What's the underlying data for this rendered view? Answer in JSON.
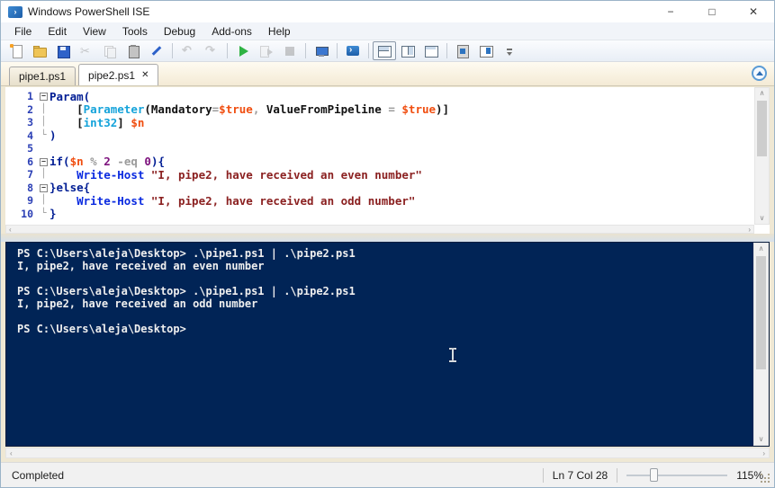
{
  "window": {
    "title": "Windows PowerShell ISE",
    "controls": {
      "minimize": "−",
      "maximize": "□",
      "close": "✕"
    }
  },
  "menu": {
    "items": [
      "File",
      "Edit",
      "View",
      "Tools",
      "Debug",
      "Add-ons",
      "Help"
    ]
  },
  "toolbar": {
    "buttons": [
      {
        "name": "new-script"
      },
      {
        "name": "open-script"
      },
      {
        "name": "save-script"
      },
      {
        "name": "cut",
        "disabled": true
      },
      {
        "name": "copy",
        "disabled": true
      },
      {
        "name": "paste"
      },
      {
        "name": "clear-console-pane"
      },
      {
        "sep": true
      },
      {
        "name": "undo",
        "disabled": true
      },
      {
        "name": "redo",
        "disabled": true
      },
      {
        "sep": true
      },
      {
        "name": "run-script"
      },
      {
        "name": "run-selection",
        "disabled": true
      },
      {
        "name": "stop-operation",
        "disabled": true
      },
      {
        "sep": true
      },
      {
        "name": "new-remote-powershell-tab"
      },
      {
        "sep": true
      },
      {
        "name": "start-powershell"
      },
      {
        "sep": true
      },
      {
        "name": "script-pane-top",
        "selected": true
      },
      {
        "name": "script-pane-right"
      },
      {
        "name": "script-pane-maximized"
      },
      {
        "sep": true
      },
      {
        "name": "show-command-window"
      },
      {
        "name": "show-command-addon"
      },
      {
        "name": "toolbar-overflow"
      }
    ]
  },
  "tabs": {
    "items": [
      {
        "label": "pipe1.ps1",
        "active": false
      },
      {
        "label": "pipe2.ps1",
        "active": true
      }
    ],
    "close_glyph": "✕"
  },
  "editor": {
    "lines": [
      {
        "n": "1",
        "fold": "minus",
        "guide": "",
        "tokens": [
          [
            "Param(",
            "kw"
          ]
        ]
      },
      {
        "n": "2",
        "fold": "",
        "guide": "│",
        "tokens": [
          [
            "    [",
            "pl"
          ],
          [
            "Parameter",
            "ty"
          ],
          [
            "(",
            "pl"
          ],
          [
            "Mandatory",
            "pl"
          ],
          [
            "=",
            "op"
          ],
          [
            "$true",
            "va"
          ],
          [
            ", ",
            "op"
          ],
          [
            "ValueFromPipeline",
            "pl"
          ],
          [
            " = ",
            "op"
          ],
          [
            "$true",
            "va"
          ],
          [
            ")]",
            "pl"
          ]
        ]
      },
      {
        "n": "3",
        "fold": "",
        "guide": "│",
        "tokens": [
          [
            "    [",
            "pl"
          ],
          [
            "int32",
            "ty"
          ],
          [
            "] ",
            "pl"
          ],
          [
            "$n",
            "va"
          ]
        ]
      },
      {
        "n": "4",
        "fold": "",
        "guide": "└",
        "tokens": [
          [
            ")",
            "kw"
          ]
        ]
      },
      {
        "n": "5",
        "fold": "",
        "guide": "",
        "tokens": []
      },
      {
        "n": "6",
        "fold": "minus",
        "guide": "",
        "tokens": [
          [
            "if(",
            "kw"
          ],
          [
            "$n",
            "va"
          ],
          [
            " ",
            "pl"
          ],
          [
            "%",
            "op"
          ],
          [
            " ",
            "pl"
          ],
          [
            "2",
            "nu"
          ],
          [
            " ",
            "pl"
          ],
          [
            "-eq",
            "op"
          ],
          [
            " ",
            "pl"
          ],
          [
            "0",
            "nu"
          ],
          [
            "){",
            "kw"
          ]
        ]
      },
      {
        "n": "7",
        "fold": "",
        "guide": "│",
        "tokens": [
          [
            "    ",
            "pl"
          ],
          [
            "Write-Host",
            "cm"
          ],
          [
            " ",
            "pl"
          ],
          [
            "\"I, pipe2, have received an even number\"",
            "st"
          ]
        ]
      },
      {
        "n": "8",
        "fold": "minus",
        "guide": "",
        "tokens": [
          [
            "}else{",
            "kw"
          ]
        ]
      },
      {
        "n": "9",
        "fold": "",
        "guide": "│",
        "tokens": [
          [
            "    ",
            "pl"
          ],
          [
            "Write-Host",
            "cm"
          ],
          [
            " ",
            "pl"
          ],
          [
            "\"I, pipe2, have received an odd number\"",
            "st"
          ]
        ]
      },
      {
        "n": "10",
        "fold": "",
        "guide": "└",
        "tokens": [
          [
            "}",
            "kw"
          ]
        ]
      }
    ]
  },
  "console": {
    "lines": [
      "PS C:\\Users\\aleja\\Desktop> .\\pipe1.ps1 | .\\pipe2.ps1",
      "I, pipe2, have received an even number",
      "",
      "PS C:\\Users\\aleja\\Desktop> .\\pipe1.ps1 | .\\pipe2.ps1",
      "I, pipe2, have received an odd number",
      "",
      "PS C:\\Users\\aleja\\Desktop>"
    ]
  },
  "status": {
    "state": "Completed",
    "line_col": "Ln 7  Col 28",
    "zoom_value": "115%"
  }
}
